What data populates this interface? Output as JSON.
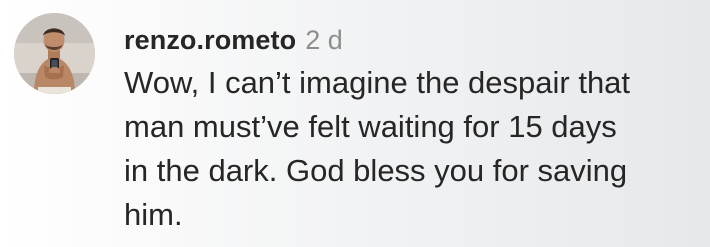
{
  "comment": {
    "username": "renzo.rometo",
    "timestamp": "2 d",
    "text_lines": [
      "Wow, I can’t imagine the despair that",
      "man must’ve felt waiting for 15 days",
      "in the dark. God bless you for saving",
      "him."
    ]
  },
  "colors": {
    "text": "#262626",
    "muted": "#8e8e8e"
  },
  "icons": {
    "avatar": "profile-photo"
  }
}
